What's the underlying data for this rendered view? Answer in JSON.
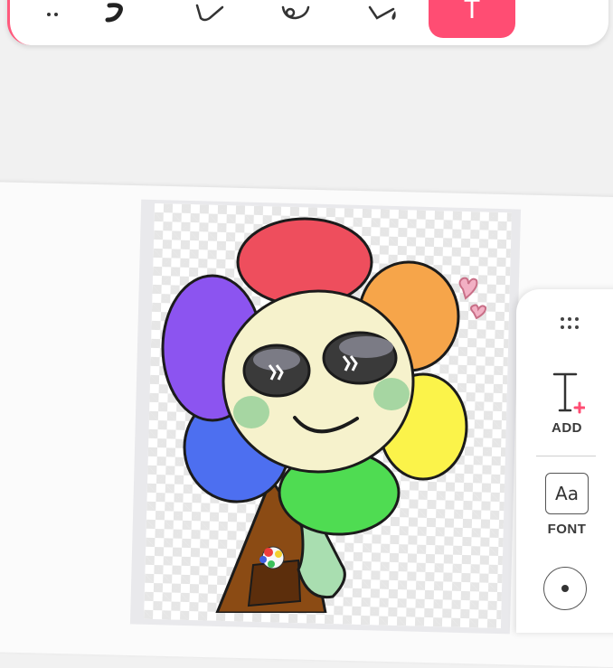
{
  "top_toolbar": {
    "tools": [
      {
        "icon": "more-dots-icon"
      },
      {
        "icon": "brush-icon"
      },
      {
        "icon": "eraser-icon"
      },
      {
        "icon": "lasso-icon"
      },
      {
        "icon": "fill-bucket-icon"
      },
      {
        "icon": "text-icon",
        "glyph": "T",
        "active": true
      }
    ]
  },
  "colors": {
    "accent": "#ff4d73",
    "petal_red": "#ee4e5d",
    "petal_orange": "#f6a54a",
    "petal_yellow": "#fbf34a",
    "petal_green": "#4fdc52",
    "petal_blue": "#4d6ff0",
    "petal_purple": "#8c54f0",
    "face": "#f6f2cc"
  },
  "text_panel": {
    "add_label": "ADD",
    "font_label": "FONT",
    "font_preview": "Aa"
  }
}
